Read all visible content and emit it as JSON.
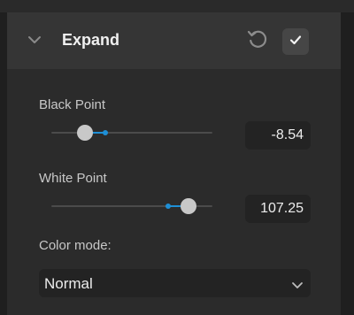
{
  "panel": {
    "title": "Expand",
    "icons": {
      "collapse": "chevron-down-icon",
      "reset": "reset-icon",
      "apply": "checkmark-icon"
    }
  },
  "black_point": {
    "label": "Black Point",
    "value": "-8.54",
    "slider_fraction": 0.21
  },
  "white_point": {
    "label": "White Point",
    "value": "107.25",
    "slider_fraction": 0.85
  },
  "color_mode": {
    "label": "Color mode:",
    "selected": "Normal"
  },
  "colors": {
    "accent": "#1e8fd6",
    "panel_bg": "#2b2b2b",
    "header_bg": "#353535",
    "input_bg": "#232323"
  }
}
